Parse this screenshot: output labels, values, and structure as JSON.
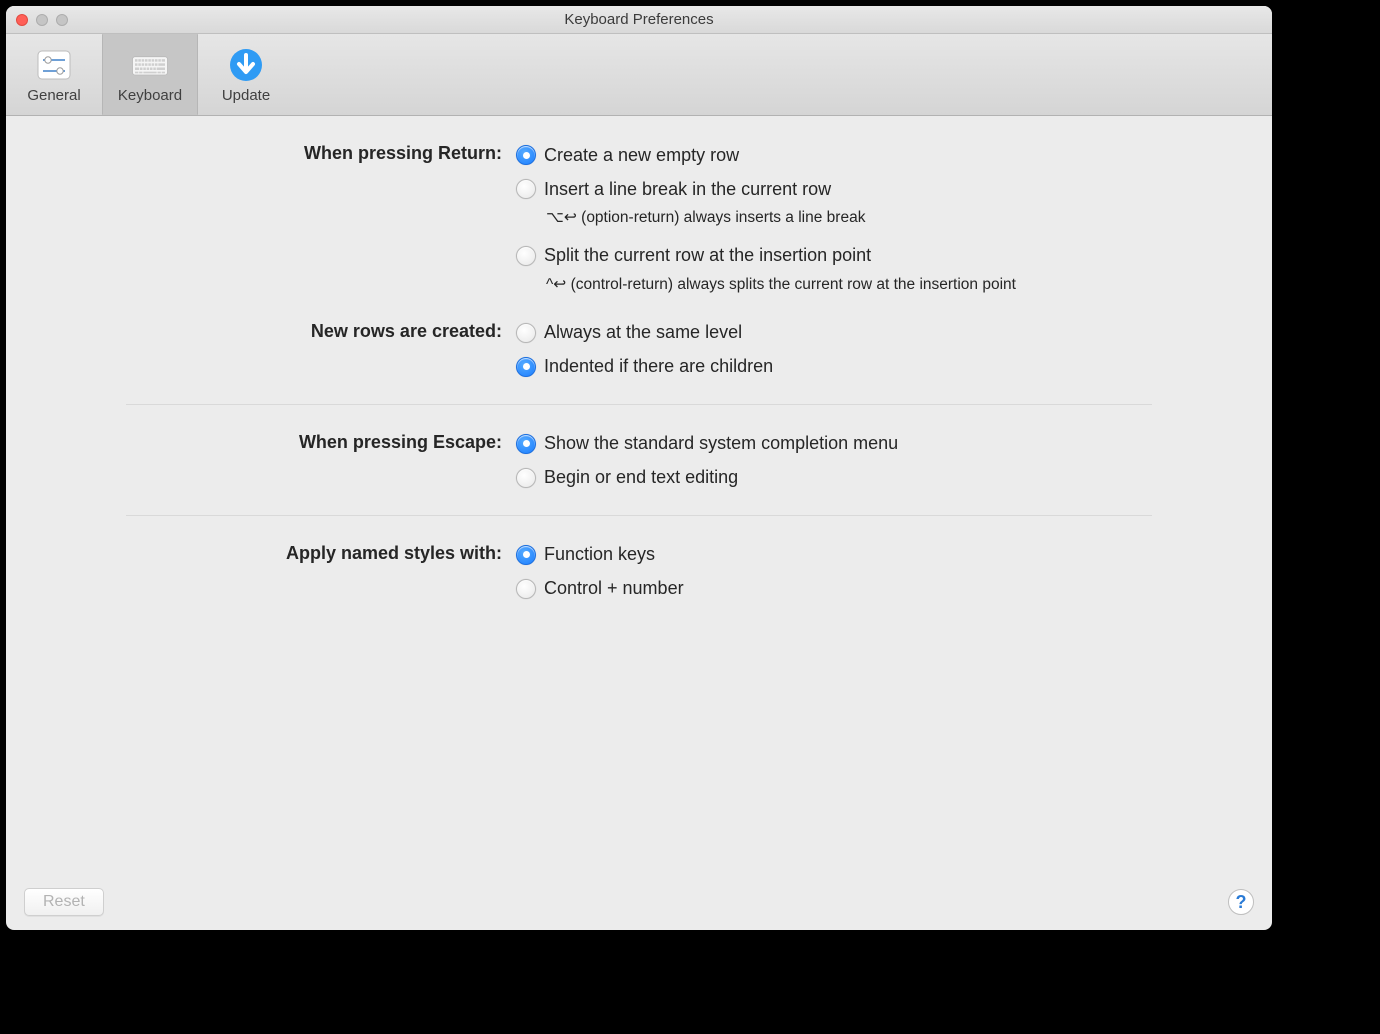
{
  "window": {
    "title": "Keyboard Preferences"
  },
  "toolbar": {
    "items": [
      {
        "label": "General"
      },
      {
        "label": "Keyboard"
      },
      {
        "label": "Update"
      }
    ],
    "selected_index": 1
  },
  "sections": {
    "return": {
      "label": "When pressing Return:",
      "options": [
        {
          "label": "Create a new empty row",
          "checked": true
        },
        {
          "label": "Insert a line break in the current row",
          "checked": false,
          "hint": "⌥↩︎ (option-return) always inserts a line break"
        },
        {
          "label": "Split the current row at the insertion point",
          "checked": false,
          "hint": "^↩︎ (control-return) always splits the current row at the insertion point"
        }
      ]
    },
    "new_rows": {
      "label": "New rows are created:",
      "options": [
        {
          "label": "Always at the same level",
          "checked": false
        },
        {
          "label": "Indented if there are children",
          "checked": true
        }
      ]
    },
    "escape": {
      "label": "When pressing Escape:",
      "options": [
        {
          "label": "Show the standard system completion menu",
          "checked": true
        },
        {
          "label": "Begin or end text editing",
          "checked": false
        }
      ]
    },
    "styles": {
      "label": "Apply named styles with:",
      "options": [
        {
          "label": "Function keys",
          "checked": true
        },
        {
          "label": "Control + number",
          "checked": false
        }
      ]
    }
  },
  "footer": {
    "reset_label": "Reset",
    "help_label": "?"
  }
}
